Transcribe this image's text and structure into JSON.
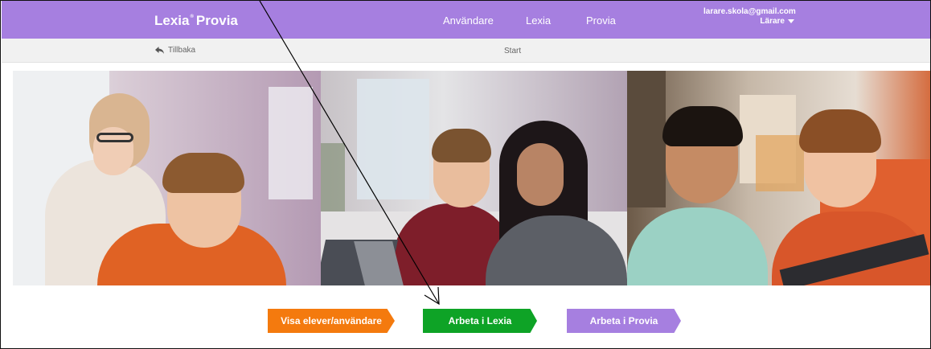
{
  "brand": {
    "name": "Lexia",
    "mark": "®",
    "product": "Provia"
  },
  "nav": {
    "users": "Användare",
    "lexia": "Lexia",
    "provia": "Provia"
  },
  "account": {
    "email": "larare.skola@gmail.com",
    "role": "Lärare"
  },
  "subbar": {
    "back_label": "Tillbaka",
    "breadcrumb": "Start"
  },
  "buttons": {
    "students": "Visa elever/användare",
    "work_lexia": "Arbeta i Lexia",
    "work_provia": "Arbeta i Provia"
  },
  "colors": {
    "header_purple": "#a67fe0",
    "orange": "#f47a0e",
    "green": "#0ea326"
  },
  "icons": {
    "back": "reply-arrow-icon",
    "role_menu": "caret-down-icon"
  }
}
